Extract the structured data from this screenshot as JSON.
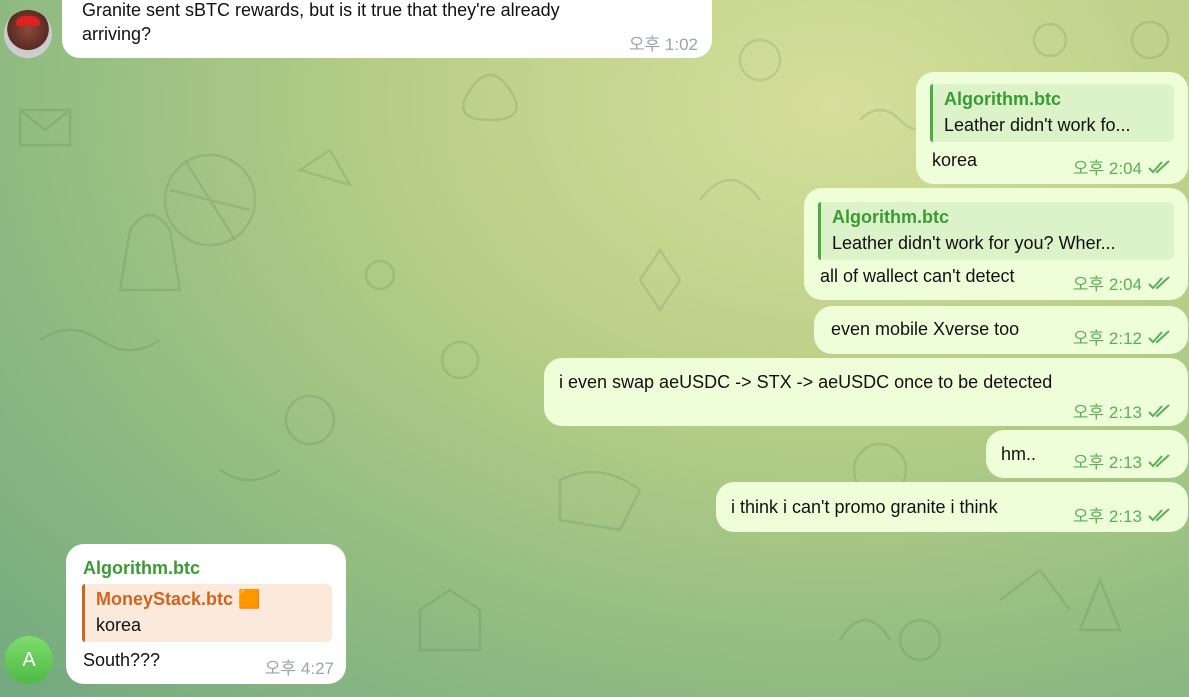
{
  "colors": {
    "out_bubble": "#eefed9",
    "in_bubble": "#ffffff",
    "name_green": "#3a9b32",
    "name_orange": "#d0651e",
    "tick_green": "#5cae5a"
  },
  "messages": [
    {
      "text_line1": "Granite sent sBTC rewards, but is it true that they're already",
      "text_line2": "arriving?",
      "time": "오후 1:02"
    },
    {
      "reply_name": "Algorithm.btc",
      "reply_text": "Leather didn't work fo...",
      "text": "korea",
      "time": "오후 2:04"
    },
    {
      "reply_name": "Algorithm.btc",
      "reply_text": "Leather didn't work for you?  Wher...",
      "text": "all of wallect can't detect",
      "time": "오후 2:04"
    },
    {
      "text": "even mobile Xverse too",
      "time": "오후 2:12"
    },
    {
      "text": "i even swap aeUSDC -> STX -> aeUSDC once to be detected",
      "time": "오후 2:13"
    },
    {
      "text": "hm..",
      "time": "오후 2:13"
    },
    {
      "text": "i think i can't promo granite i think",
      "time": "오후 2:13"
    },
    {
      "sender": "Algorithm.btc",
      "reply_name": "MoneyStack.btc 🟧",
      "reply_text": "korea",
      "text": "South???",
      "time": "오후 4:27",
      "avatar_letter": "A"
    }
  ]
}
